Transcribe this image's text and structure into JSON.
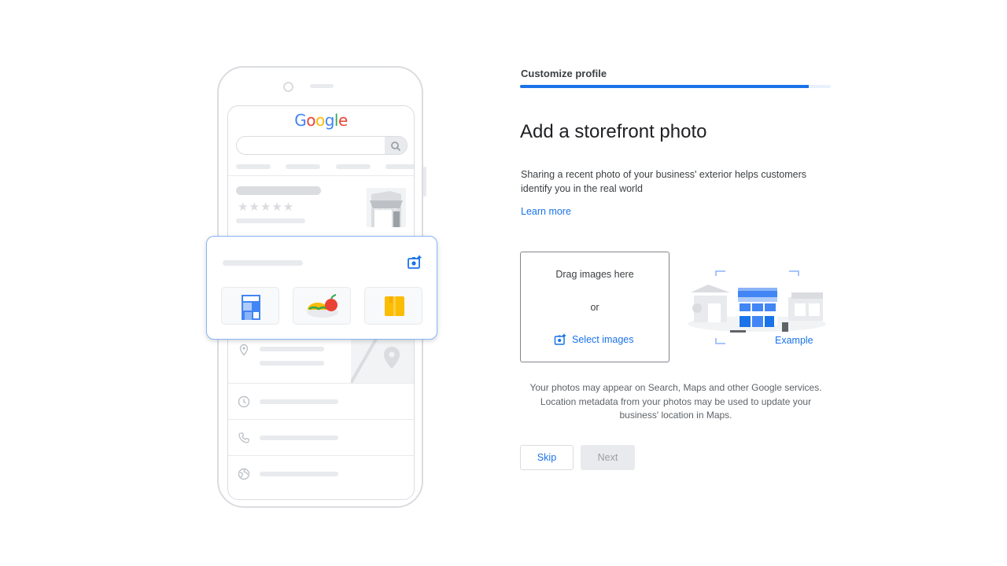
{
  "phone_illustration": {
    "brand_letters": [
      {
        "ch": "G",
        "color": "#4285F4"
      },
      {
        "ch": "o",
        "color": "#EA4335"
      },
      {
        "ch": "o",
        "color": "#FBBC05"
      },
      {
        "ch": "g",
        "color": "#4285F4"
      },
      {
        "ch": "l",
        "color": "#34A853"
      },
      {
        "ch": "e",
        "color": "#EA4335"
      }
    ],
    "stars": "★★★★★",
    "icons": [
      "search-icon",
      "storefront-icon",
      "add-photo-icon",
      "location-pin-icon",
      "clock-icon",
      "phone-icon",
      "globe-icon"
    ]
  },
  "step": {
    "label": "Customize profile",
    "progress_fraction": 0.93
  },
  "heading": "Add a storefront photo",
  "description": "Sharing a recent photo of your business' exterior helps customers identify you in the real world",
  "learn_more": "Learn more",
  "dropzone": {
    "drag_text": "Drag images here",
    "or_text": "or",
    "select_label": "Select images",
    "select_icon": "add-photo-icon"
  },
  "example_label": "Example",
  "notice": "Your photos may appear on Search, Maps and other Google services. Location metadata from your photos may be used to update your business' location in Maps.",
  "buttons": {
    "skip": "Skip",
    "next": "Next"
  },
  "colors": {
    "accent": "#1a73e8",
    "progress_track": "#e8f0fe",
    "disabled_bg": "#e8eaed",
    "disabled_text": "#9aa0a6"
  }
}
